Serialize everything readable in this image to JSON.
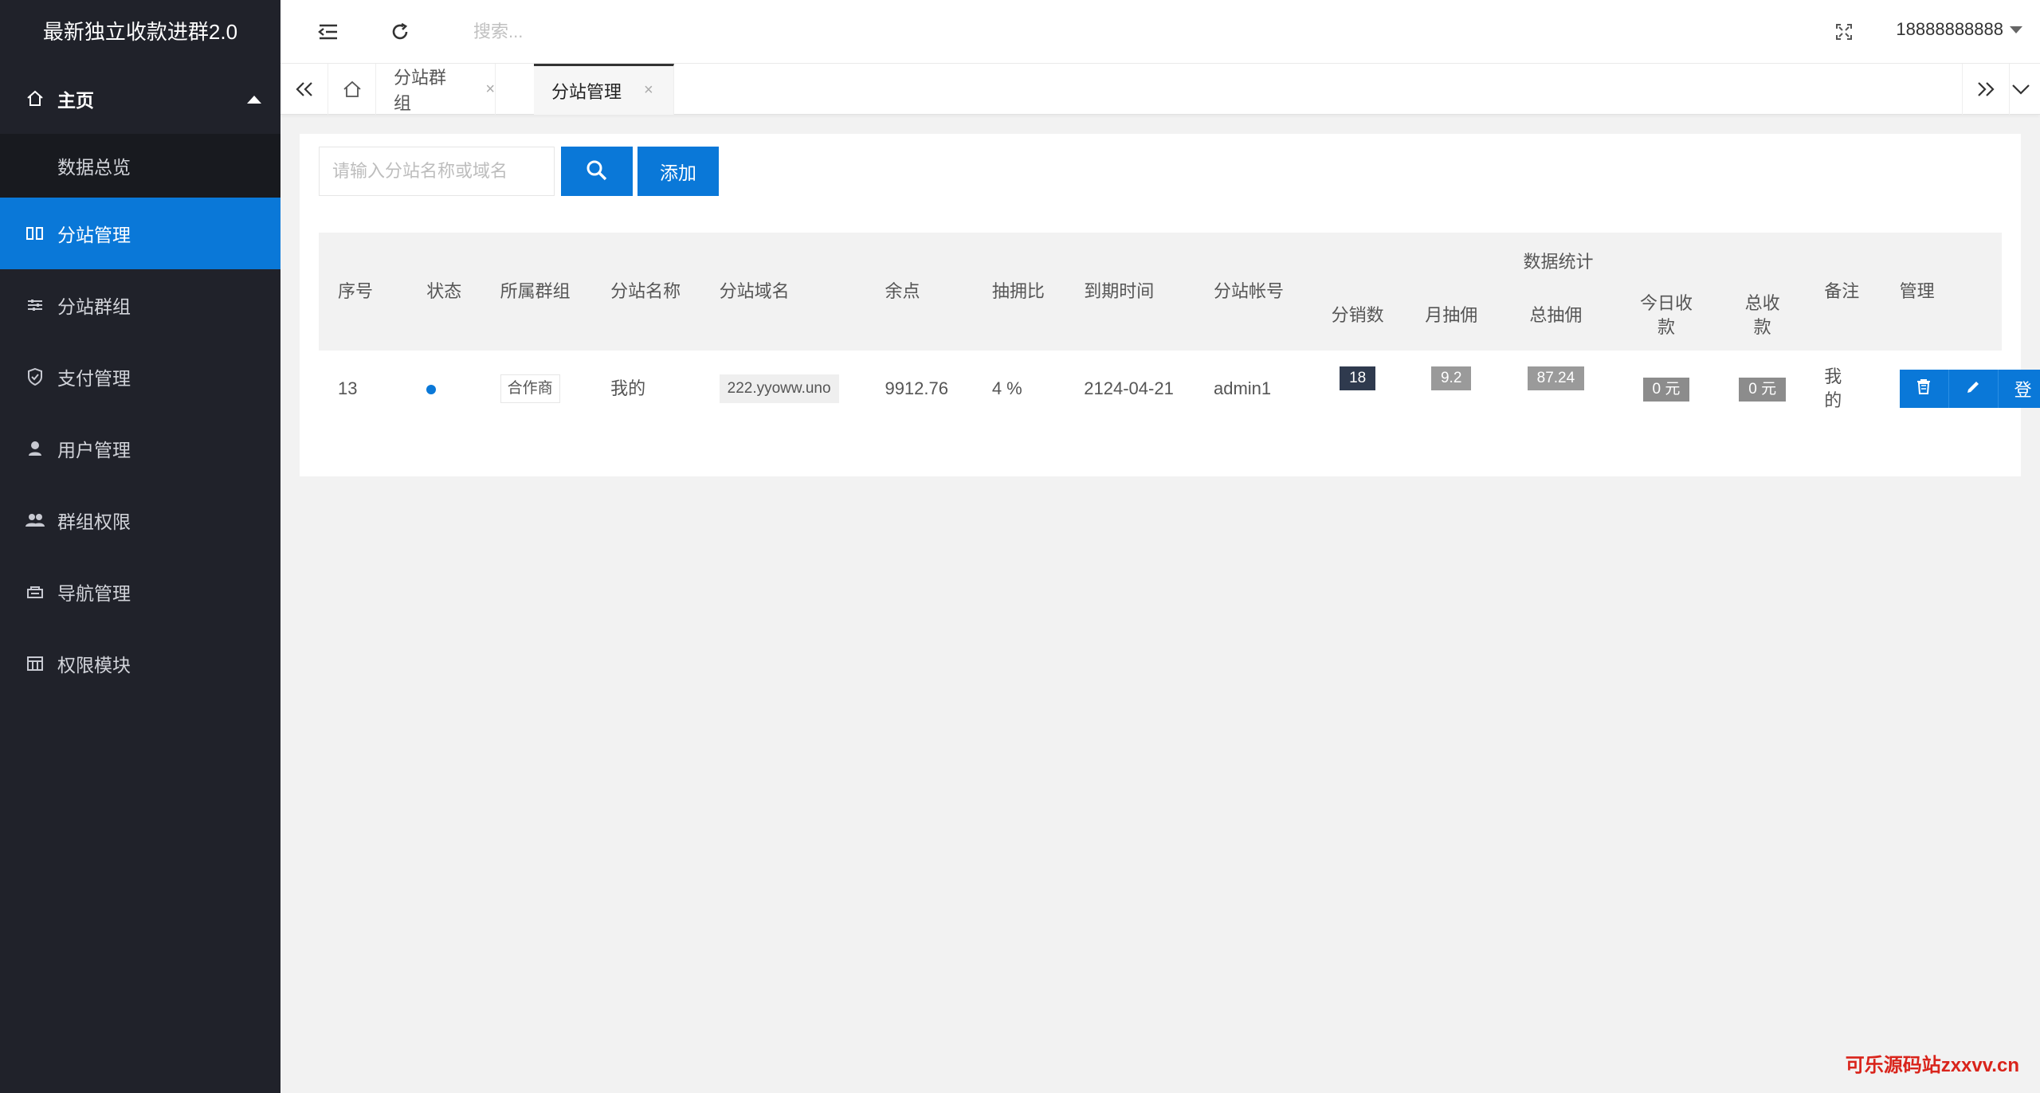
{
  "app": {
    "title": "最新独立收款进群2.0"
  },
  "sidebar": {
    "home": {
      "label": "主页",
      "icon": "home-icon"
    },
    "sub_items": [
      {
        "label": "数据总览"
      }
    ],
    "items": [
      {
        "label": "分站管理",
        "icon": "columns-icon",
        "active": true
      },
      {
        "label": "分站群组",
        "icon": "sliders-icon",
        "active": false
      },
      {
        "label": "支付管理",
        "icon": "shield-check-icon",
        "active": false
      },
      {
        "label": "用户管理",
        "icon": "user-icon",
        "active": false
      },
      {
        "label": "群组权限",
        "icon": "users-icon",
        "active": false
      },
      {
        "label": "导航管理",
        "icon": "nav-icon",
        "active": false
      },
      {
        "label": "权限模块",
        "icon": "module-icon",
        "active": false
      }
    ]
  },
  "header": {
    "search_placeholder": "搜索...",
    "user": "18888888888"
  },
  "tabs": [
    {
      "label": "分站群组",
      "close": "×",
      "active": false
    },
    {
      "label": "分站管理",
      "close": "×",
      "active": true
    }
  ],
  "toolbar": {
    "search_placeholder": "请输入分站名称或域名",
    "add_label": "添加"
  },
  "table": {
    "headers": {
      "index": "序号",
      "status": "状态",
      "group": "所属群组",
      "name": "分站名称",
      "domain": "分站域名",
      "balance": "余点",
      "ratio": "抽拥比",
      "expire": "到期时间",
      "account": "分站帐号",
      "stats": "数据统计",
      "distributors": "分销数",
      "monthly": "月抽佣",
      "total_commission": "总抽佣",
      "today_income": "今日收款",
      "total_income": "总收款",
      "remark": "备注",
      "manage": "管理"
    },
    "rows": [
      {
        "index": "13",
        "group": "合作商",
        "name": "我的",
        "domain": "222.yyoww.uno",
        "balance": "9912.76",
        "ratio": "4 %",
        "expire": "2124-04-21",
        "account": "admin1",
        "distributors": "18",
        "monthly": "9.2",
        "total_commission": "87.24",
        "today_income": "0 元",
        "total_income": "0 元",
        "remark": "我的",
        "login_label": "登"
      }
    ]
  },
  "colors": {
    "primary": "#0a78d8",
    "sidebar_bg": "#20222a",
    "badge_dark": "#2f3a4e",
    "badge_gray": "#9a9a9a",
    "watermark": "#d9241b"
  },
  "watermark": "可乐源码站zxxvv.cn"
}
